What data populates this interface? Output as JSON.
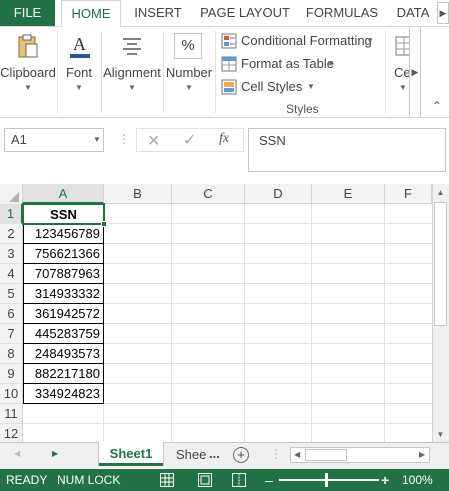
{
  "ribbon_tabs": {
    "file": "FILE",
    "home": "HOME",
    "insert": "INSERT",
    "page_layout": "PAGE LAYOUT",
    "formulas": "FORMULAS",
    "data": "DATA"
  },
  "ribbon": {
    "clipboard": "Clipboard",
    "font": "Font",
    "alignment": "Alignment",
    "number": "Number",
    "conditional_formatting": "Conditional Formatting",
    "format_as_table": "Format as Table",
    "cell_styles": "Cell Styles",
    "styles_group": "Styles",
    "cells": "Ce"
  },
  "formula_bar": {
    "name_box": "A1",
    "fx": "fx",
    "value": "SSN"
  },
  "columns": [
    "A",
    "B",
    "C",
    "D",
    "E",
    "F"
  ],
  "rows": [
    "1",
    "2",
    "3",
    "4",
    "5",
    "6",
    "7",
    "8",
    "9",
    "10",
    "11",
    "12"
  ],
  "cells": {
    "header": "SSN",
    "values": [
      "123456789",
      "756621366",
      "707887963",
      "314933332",
      "361942572",
      "445283759",
      "248493573",
      "882217180",
      "334924823"
    ]
  },
  "sheets": {
    "active": "Sheet1",
    "other": "Shee",
    "more": "..."
  },
  "status": {
    "mode": "READY",
    "num_lock": "NUM LOCK",
    "zoom": "100%"
  },
  "colors": {
    "accent": "#217346"
  }
}
